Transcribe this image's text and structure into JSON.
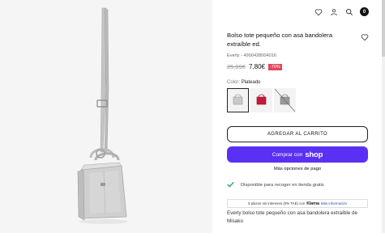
{
  "product": {
    "title": "Bolso tote pequeño con asa bandolera extraíble ed.",
    "sku": "Everly - 4900428004016",
    "old_price": "25,99€",
    "price": "7,80€",
    "discount": "-70%",
    "color_label": "Color:",
    "color_value": "Plateado"
  },
  "header": {
    "cart_count": "0",
    "icons": [
      "heart-icon",
      "user-icon",
      "search-icon",
      "bag-icon"
    ]
  },
  "swatches": [
    {
      "name": "plateado",
      "color": "#c9c9c9",
      "selected": true,
      "available": true
    },
    {
      "name": "rojo",
      "color": "#c8183a",
      "selected": false,
      "available": true
    },
    {
      "name": "gris",
      "color": "#9a9a9a",
      "selected": false,
      "available": false
    }
  ],
  "actions": {
    "add_to_cart": "AGREGAR AL CARRITO",
    "shop_prefix": "Comprar con",
    "shop_brand": "shop",
    "more_payment": "Más opciones de pago"
  },
  "pickup": {
    "text": "Disponible para recoger en tienda gratis"
  },
  "klarna": {
    "text": "3 plazos sin intereses (0% TAE) con",
    "brand": "Klarna",
    "link": "Más información"
  },
  "description": "Everly bolso tote pequeño con asa bandolera extraíble de Misako",
  "colors": {
    "accent": "#5a31f4",
    "discount": "#e4455c",
    "check": "#2aa36b"
  }
}
